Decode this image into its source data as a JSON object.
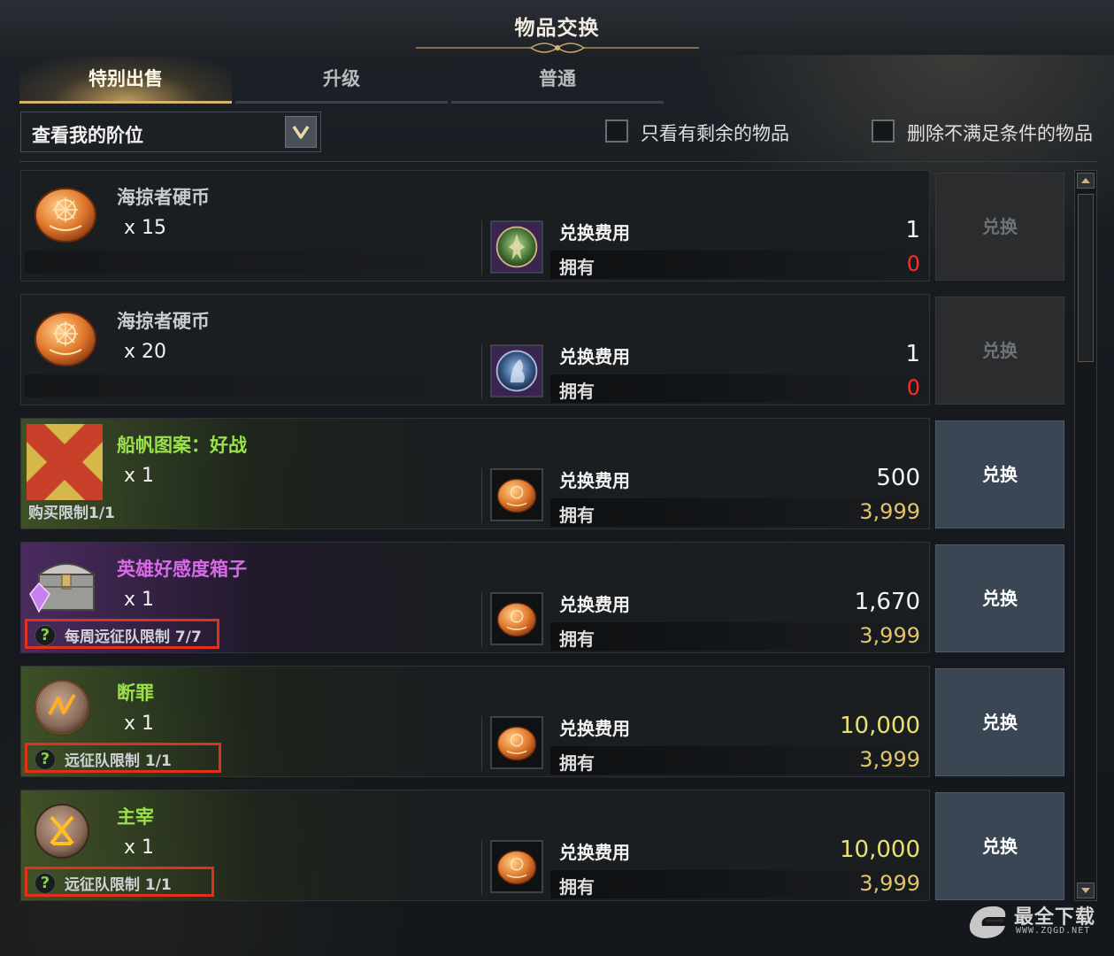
{
  "window": {
    "title": "物品交换"
  },
  "tabs": [
    {
      "label": "特别出售",
      "active": true
    },
    {
      "label": "升级",
      "active": false
    },
    {
      "label": "普通",
      "active": false
    }
  ],
  "filter": {
    "dropdown_value": "查看我的阶位",
    "checkbox_remaining": {
      "label": "只看有剩余的物品",
      "checked": false
    },
    "checkbox_hide_unmet": {
      "label": "删除不满足条件的物品",
      "checked": false
    }
  },
  "labels": {
    "cost": "兑换费用",
    "owned": "拥有",
    "exchange": "兑换"
  },
  "items": [
    {
      "name": "海掠者硬币",
      "name_color": "#c9ccce",
      "qty": "x 15",
      "icon": "pirate-coin-icon",
      "cost_icon": "green-emblem-icon",
      "cost": "1",
      "owned": "0",
      "owned_color": "red",
      "limit": "",
      "button_enabled": false
    },
    {
      "name": "海掠者硬币",
      "name_color": "#c9ccce",
      "qty": "x 20",
      "icon": "pirate-coin-icon",
      "cost_icon": "blue-emblem-icon",
      "cost": "1",
      "owned": "0",
      "owned_color": "red",
      "limit": "",
      "button_enabled": false
    },
    {
      "name": "船帆图案：好战",
      "name_color": "#9ae04a",
      "qty": "x 1",
      "icon": "sail-pattern-icon",
      "cost_icon": "pirate-coin-icon",
      "cost": "500",
      "owned": "3,999",
      "owned_color": "gold",
      "limit": "购买限制1/1",
      "button_enabled": true
    },
    {
      "name": "英雄好感度箱子",
      "name_color": "#d86ae8",
      "qty": "x 1",
      "icon": "chest-icon",
      "cost_icon": "pirate-coin-icon",
      "cost": "1,670",
      "owned": "3,999",
      "owned_color": "gold",
      "limit": "每周远征队限制 7/7",
      "button_enabled": true
    },
    {
      "name": "断罪",
      "name_color": "#9ae04a",
      "qty": "x 1",
      "icon": "rune-judgment-icon",
      "cost_icon": "pirate-coin-icon",
      "cost": "10,000",
      "cost_color": "yellow",
      "owned": "3,999",
      "owned_color": "gold",
      "limit": "远征队限制 1/1",
      "button_enabled": true
    },
    {
      "name": "主宰",
      "name_color": "#9ae04a",
      "qty": "x 1",
      "icon": "rune-dominion-icon",
      "cost_icon": "pirate-coin-icon",
      "cost": "10,000",
      "cost_color": "yellow",
      "owned": "3,999",
      "owned_color": "gold",
      "limit": "远征队限制 1/1",
      "button_enabled": true
    }
  ],
  "watermark": {
    "text": "最全下载",
    "sub": "WWW.ZQGD.NET"
  }
}
